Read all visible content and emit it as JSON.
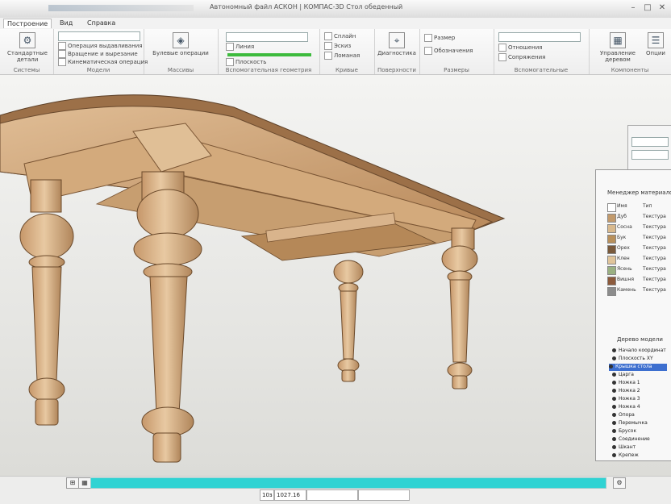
{
  "window": {
    "title": "Автономный файл АСКОН | КОМПАС-3D Стол обеденный",
    "controls": [
      "–",
      "□",
      "✕"
    ]
  },
  "ribbon_tabs": [
    {
      "label": "Построение",
      "active": true
    },
    {
      "label": "Вид"
    },
    {
      "label": "Справка"
    }
  ],
  "ribbon": {
    "groups": [
      {
        "label": "Системы",
        "buttons": [
          {
            "label": "Стандартные детали",
            "icon": "part-icon"
          }
        ]
      },
      {
        "label": "Модели",
        "rows": [
          "Операция выдавливания",
          "Вращение и вырезание",
          "Кинематическая операция"
        ]
      },
      {
        "label": "Массивы",
        "buttons": [
          {
            "label": "Булевые операции",
            "icon": "boolean-icon"
          }
        ]
      },
      {
        "label": "Вспомогательная геометрия",
        "rows": [
          "Линия",
          "Плоскость"
        ]
      },
      {
        "label": "Кривые",
        "rows": [
          "Сплайн",
          "Эскиз",
          "Ломаная"
        ]
      },
      {
        "label": "Поверхности",
        "buttons": [
          {
            "label": "Диагностика",
            "icon": "diagnostics-icon"
          }
        ]
      },
      {
        "label": "Размеры",
        "rows": [
          "Размер",
          "Обозначения"
        ]
      },
      {
        "label": "Вспомогательные",
        "rows": [
          "Отношения",
          "Сопряжения"
        ]
      },
      {
        "label": "Компоненты",
        "buttons": [
          {
            "label": "Управление деревом",
            "icon": "tree-icon"
          },
          {
            "label": "Опции",
            "icon": "options-icon"
          }
        ]
      }
    ]
  },
  "materials_panel": {
    "title": "Менеджер материалов",
    "rows": [
      {
        "name": "Имя",
        "value": "Тип",
        "color": "#ffffff"
      },
      {
        "name": "Дуб",
        "value": "Текстура",
        "color": "#c29a6c"
      },
      {
        "name": "Сосна",
        "value": "Текстура",
        "color": "#d8b98e"
      },
      {
        "name": "Бук",
        "value": "Текстура",
        "color": "#b8905c"
      },
      {
        "name": "Орех",
        "value": "Текстура",
        "color": "#7a5a3c"
      },
      {
        "name": "Клен",
        "value": "Текстура",
        "color": "#e0c49a"
      },
      {
        "name": "Ясень",
        "value": "Текстура",
        "color": "#9ab082"
      },
      {
        "name": "Вишня",
        "value": "Текстура",
        "color": "#8c5a3c"
      },
      {
        "name": "Камень",
        "value": "Текстура",
        "color": "#8c8c8c"
      }
    ]
  },
  "model_tree": {
    "title": "Дерево модели",
    "items": [
      {
        "label": "Начало координат"
      },
      {
        "label": "Плоскость XY"
      },
      {
        "label": "Крышка стола",
        "selected": true
      },
      {
        "label": "Царга"
      },
      {
        "label": "Ножка 1"
      },
      {
        "label": "Ножка 2"
      },
      {
        "label": "Ножка 3"
      },
      {
        "label": "Ножка 4"
      },
      {
        "label": "Опора"
      },
      {
        "label": "Перемычка"
      },
      {
        "label": "Брусок"
      },
      {
        "label": "Соединение"
      },
      {
        "label": "Шкант"
      },
      {
        "label": "Крепеж"
      }
    ]
  },
  "status": {
    "progress": 1.0,
    "coord_label": "10з",
    "coord_value": "1027.16",
    "fields": [
      "",
      ""
    ]
  },
  "colors": {
    "progress": "#2fd3d3",
    "selection": "#3d6fcf",
    "wood_light": "#d9b48c",
    "wood_mid": "#c39466",
    "wood_dark": "#8c6440"
  }
}
